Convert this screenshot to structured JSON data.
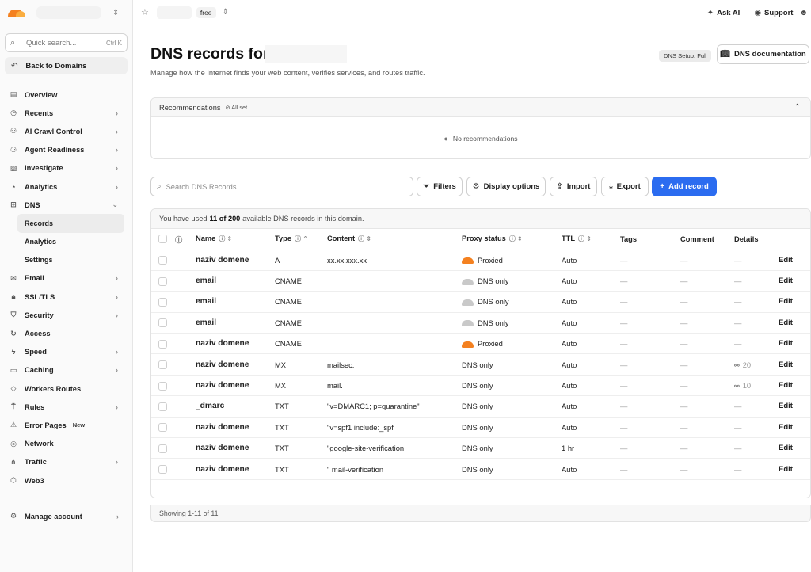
{
  "sidebar": {
    "search_placeholder": "Quick search...",
    "search_shortcut": "Ctrl K",
    "back_label": "Back to Domains",
    "items": [
      {
        "label": "Overview",
        "icon": "document-icon"
      },
      {
        "label": "Recents",
        "icon": "clock-icon"
      },
      {
        "label": "AI Crawl Control",
        "icon": "robot-icon"
      },
      {
        "label": "Agent Readiness",
        "icon": "agent-icon"
      },
      {
        "label": "Investigate",
        "icon": "investigate-icon"
      },
      {
        "label": "Analytics",
        "icon": "analytics-icon"
      },
      {
        "label": "DNS",
        "icon": "dns-icon"
      }
    ],
    "dns_sub": [
      "Records",
      "Analytics",
      "Settings"
    ],
    "items2": [
      {
        "label": "Email",
        "icon": "email-icon"
      },
      {
        "label": "SSL/TLS",
        "icon": "lock-icon"
      },
      {
        "label": "Security",
        "icon": "shield-icon"
      },
      {
        "label": "Access",
        "icon": "access-icon"
      },
      {
        "label": "Speed",
        "icon": "speed-icon"
      },
      {
        "label": "Caching",
        "icon": "caching-icon"
      },
      {
        "label": "Workers Routes",
        "icon": "workers-icon"
      },
      {
        "label": "Rules",
        "icon": "rules-icon"
      },
      {
        "label": "Error Pages",
        "icon": "error-icon",
        "badge": "New"
      },
      {
        "label": "Network",
        "icon": "network-icon"
      },
      {
        "label": "Traffic",
        "icon": "traffic-icon"
      },
      {
        "label": "Web3",
        "icon": "web3-icon"
      }
    ],
    "manage_label": "Manage account"
  },
  "topbar": {
    "plan": "free",
    "ask_ai": "Ask AI",
    "support": "Support"
  },
  "page": {
    "title": "DNS records for",
    "subtitle": "Manage how the Internet finds your web content, verifies services, and routes traffic.",
    "setup_badge": "DNS Setup: Full",
    "doc_button": "DNS documentation"
  },
  "recommendations": {
    "title": "Recommendations",
    "status": "All set",
    "empty": "No recommendations"
  },
  "toolbar": {
    "search_placeholder": "Search DNS Records",
    "filters": "Filters",
    "display_options": "Display options",
    "import": "Import",
    "export": "Export",
    "add_record": "Add record"
  },
  "table": {
    "usage_prefix": "You have used",
    "usage_count": "11 of 200",
    "usage_suffix": "available DNS records in this domain.",
    "headers": [
      "Name",
      "Type",
      "Content",
      "Proxy status",
      "TTL",
      "Tags",
      "Comment",
      "Details"
    ],
    "rows": [
      {
        "name": "naziv domene",
        "type": "A",
        "content": "xx.xx.xxx.xx",
        "proxy": "Proxied",
        "proxied": true,
        "ttl": "Auto",
        "tags": "—",
        "comment": "—",
        "details": "—",
        "edit": "Edit"
      },
      {
        "name": "email",
        "type": "CNAME",
        "content": "",
        "proxy": "DNS only",
        "proxied": false,
        "ttl": "Auto",
        "tags": "—",
        "comment": "—",
        "details": "—",
        "edit": "Edit"
      },
      {
        "name": "email",
        "type": "CNAME",
        "content": "",
        "proxy": "DNS only",
        "proxied": false,
        "ttl": "Auto",
        "tags": "—",
        "comment": "—",
        "details": "—",
        "edit": "Edit"
      },
      {
        "name": "email",
        "type": "CNAME",
        "content": "",
        "proxy": "DNS only",
        "proxied": false,
        "ttl": "Auto",
        "tags": "—",
        "comment": "—",
        "details": "—",
        "edit": "Edit"
      },
      {
        "name": "naziv domene",
        "type": "CNAME",
        "content": "",
        "proxy": "Proxied",
        "proxied": true,
        "ttl": "Auto",
        "tags": "—",
        "comment": "—",
        "details": "—",
        "edit": "Edit"
      },
      {
        "name": "naziv domene",
        "type": "MX",
        "content": "mailsec.",
        "proxy": "DNS only",
        "proxied": null,
        "ttl": "Auto",
        "tags": "—",
        "comment": "—",
        "details": "20",
        "edit": "Edit"
      },
      {
        "name": "naziv domene",
        "type": "MX",
        "content": "mail.",
        "proxy": "DNS only",
        "proxied": null,
        "ttl": "Auto",
        "tags": "—",
        "comment": "—",
        "details": "10",
        "edit": "Edit"
      },
      {
        "name": "_dmarc",
        "type": "TXT",
        "content": "\"v=DMARC1; p=quarantine\"",
        "proxy": "DNS only",
        "proxied": null,
        "ttl": "Auto",
        "tags": "—",
        "comment": "—",
        "details": "—",
        "edit": "Edit"
      },
      {
        "name": "naziv domene",
        "type": "TXT",
        "content": "\"v=spf1 include:_spf",
        "proxy": "DNS only",
        "proxied": null,
        "ttl": "Auto",
        "tags": "—",
        "comment": "—",
        "details": "—",
        "edit": "Edit"
      },
      {
        "name": "naziv domene",
        "type": "TXT",
        "content": "\"google-site-verification",
        "proxy": "DNS only",
        "proxied": null,
        "ttl": "1 hr",
        "tags": "—",
        "comment": "—",
        "details": "—",
        "edit": "Edit"
      },
      {
        "name": "naziv domene",
        "type": "TXT",
        "content": "\"          mail-verification",
        "proxy": "DNS only",
        "proxied": null,
        "ttl": "Auto",
        "tags": "—",
        "comment": "—",
        "details": "—",
        "edit": "Edit"
      }
    ],
    "footer": "Showing 1-11 of 11"
  },
  "colors": {
    "accent": "#2b6cf0",
    "proxied": "#f48120",
    "dns_only": "#c9c9c9"
  }
}
